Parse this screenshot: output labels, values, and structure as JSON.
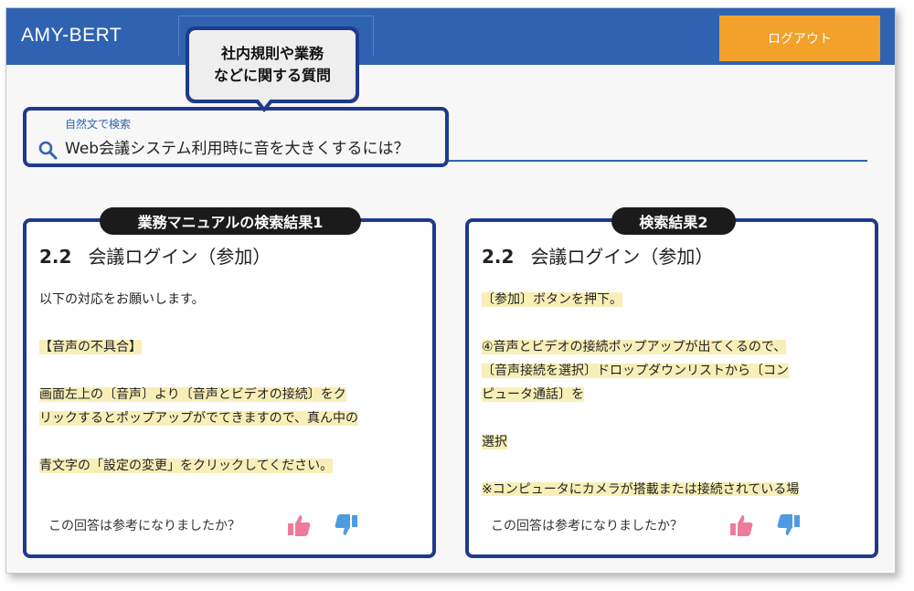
{
  "header": {
    "brand": "AMY-BERT",
    "logout_label": "ログアウト",
    "color": "#2f63b2",
    "logout_color": "#f2a12a"
  },
  "callout": {
    "line1": "社内規則や業務",
    "line2": "などに関する質問"
  },
  "search": {
    "label": "自然文で検索",
    "value": "Web会議システム利用時に音を大きくするには？",
    "icon": "search-icon"
  },
  "results": [
    {
      "pill": "業務マニュアルの検索結果1",
      "section_number": "2.2",
      "section_title": "会議ログイン（参加）",
      "lines": [
        {
          "text": "以下の対応をお願いします。",
          "highlight": false
        },
        {
          "text": "",
          "highlight": false
        },
        {
          "text": "【音声の不具合】",
          "highlight": true
        },
        {
          "text": "",
          "highlight": false
        },
        {
          "text": "画面左上の〔音声〕より〔音声とビデオの接続〕をク",
          "highlight": true
        },
        {
          "text": "リックするとポップアップがでてきますので、真ん中の",
          "highlight": true
        },
        {
          "text": "",
          "highlight": false
        },
        {
          "text": "青文字の「設定の変更」をクリックしてください。",
          "highlight": true
        }
      ],
      "feedback": "この回答は参考になりましたか？"
    },
    {
      "pill": "検索結果2",
      "section_number": "2.2",
      "section_title": "会議ログイン（参加）",
      "lines": [
        {
          "text": "〔参加〕ボタンを押下。",
          "highlight": true
        },
        {
          "text": "",
          "highlight": false
        },
        {
          "text": "④音声とビデオの接続ポップアップが出てくるので、",
          "highlight": true
        },
        {
          "text": "〔音声接続を選択〕ドロップダウンリストから〔コン",
          "highlight": true
        },
        {
          "text": "ピュータ通話〕を",
          "highlight": true
        },
        {
          "text": "",
          "highlight": false
        },
        {
          "text": "選択",
          "highlight": true
        },
        {
          "text": "",
          "highlight": false
        },
        {
          "text": "※コンピュータにカメラが搭載または接続されている場",
          "highlight": true
        }
      ],
      "feedback": "この回答は参考になりましたか？"
    }
  ],
  "colors": {
    "highlight": "#f8efb8",
    "border": "#1f3a8c",
    "thumb_up": "#ef7b9a",
    "thumb_down": "#4f9be0"
  }
}
